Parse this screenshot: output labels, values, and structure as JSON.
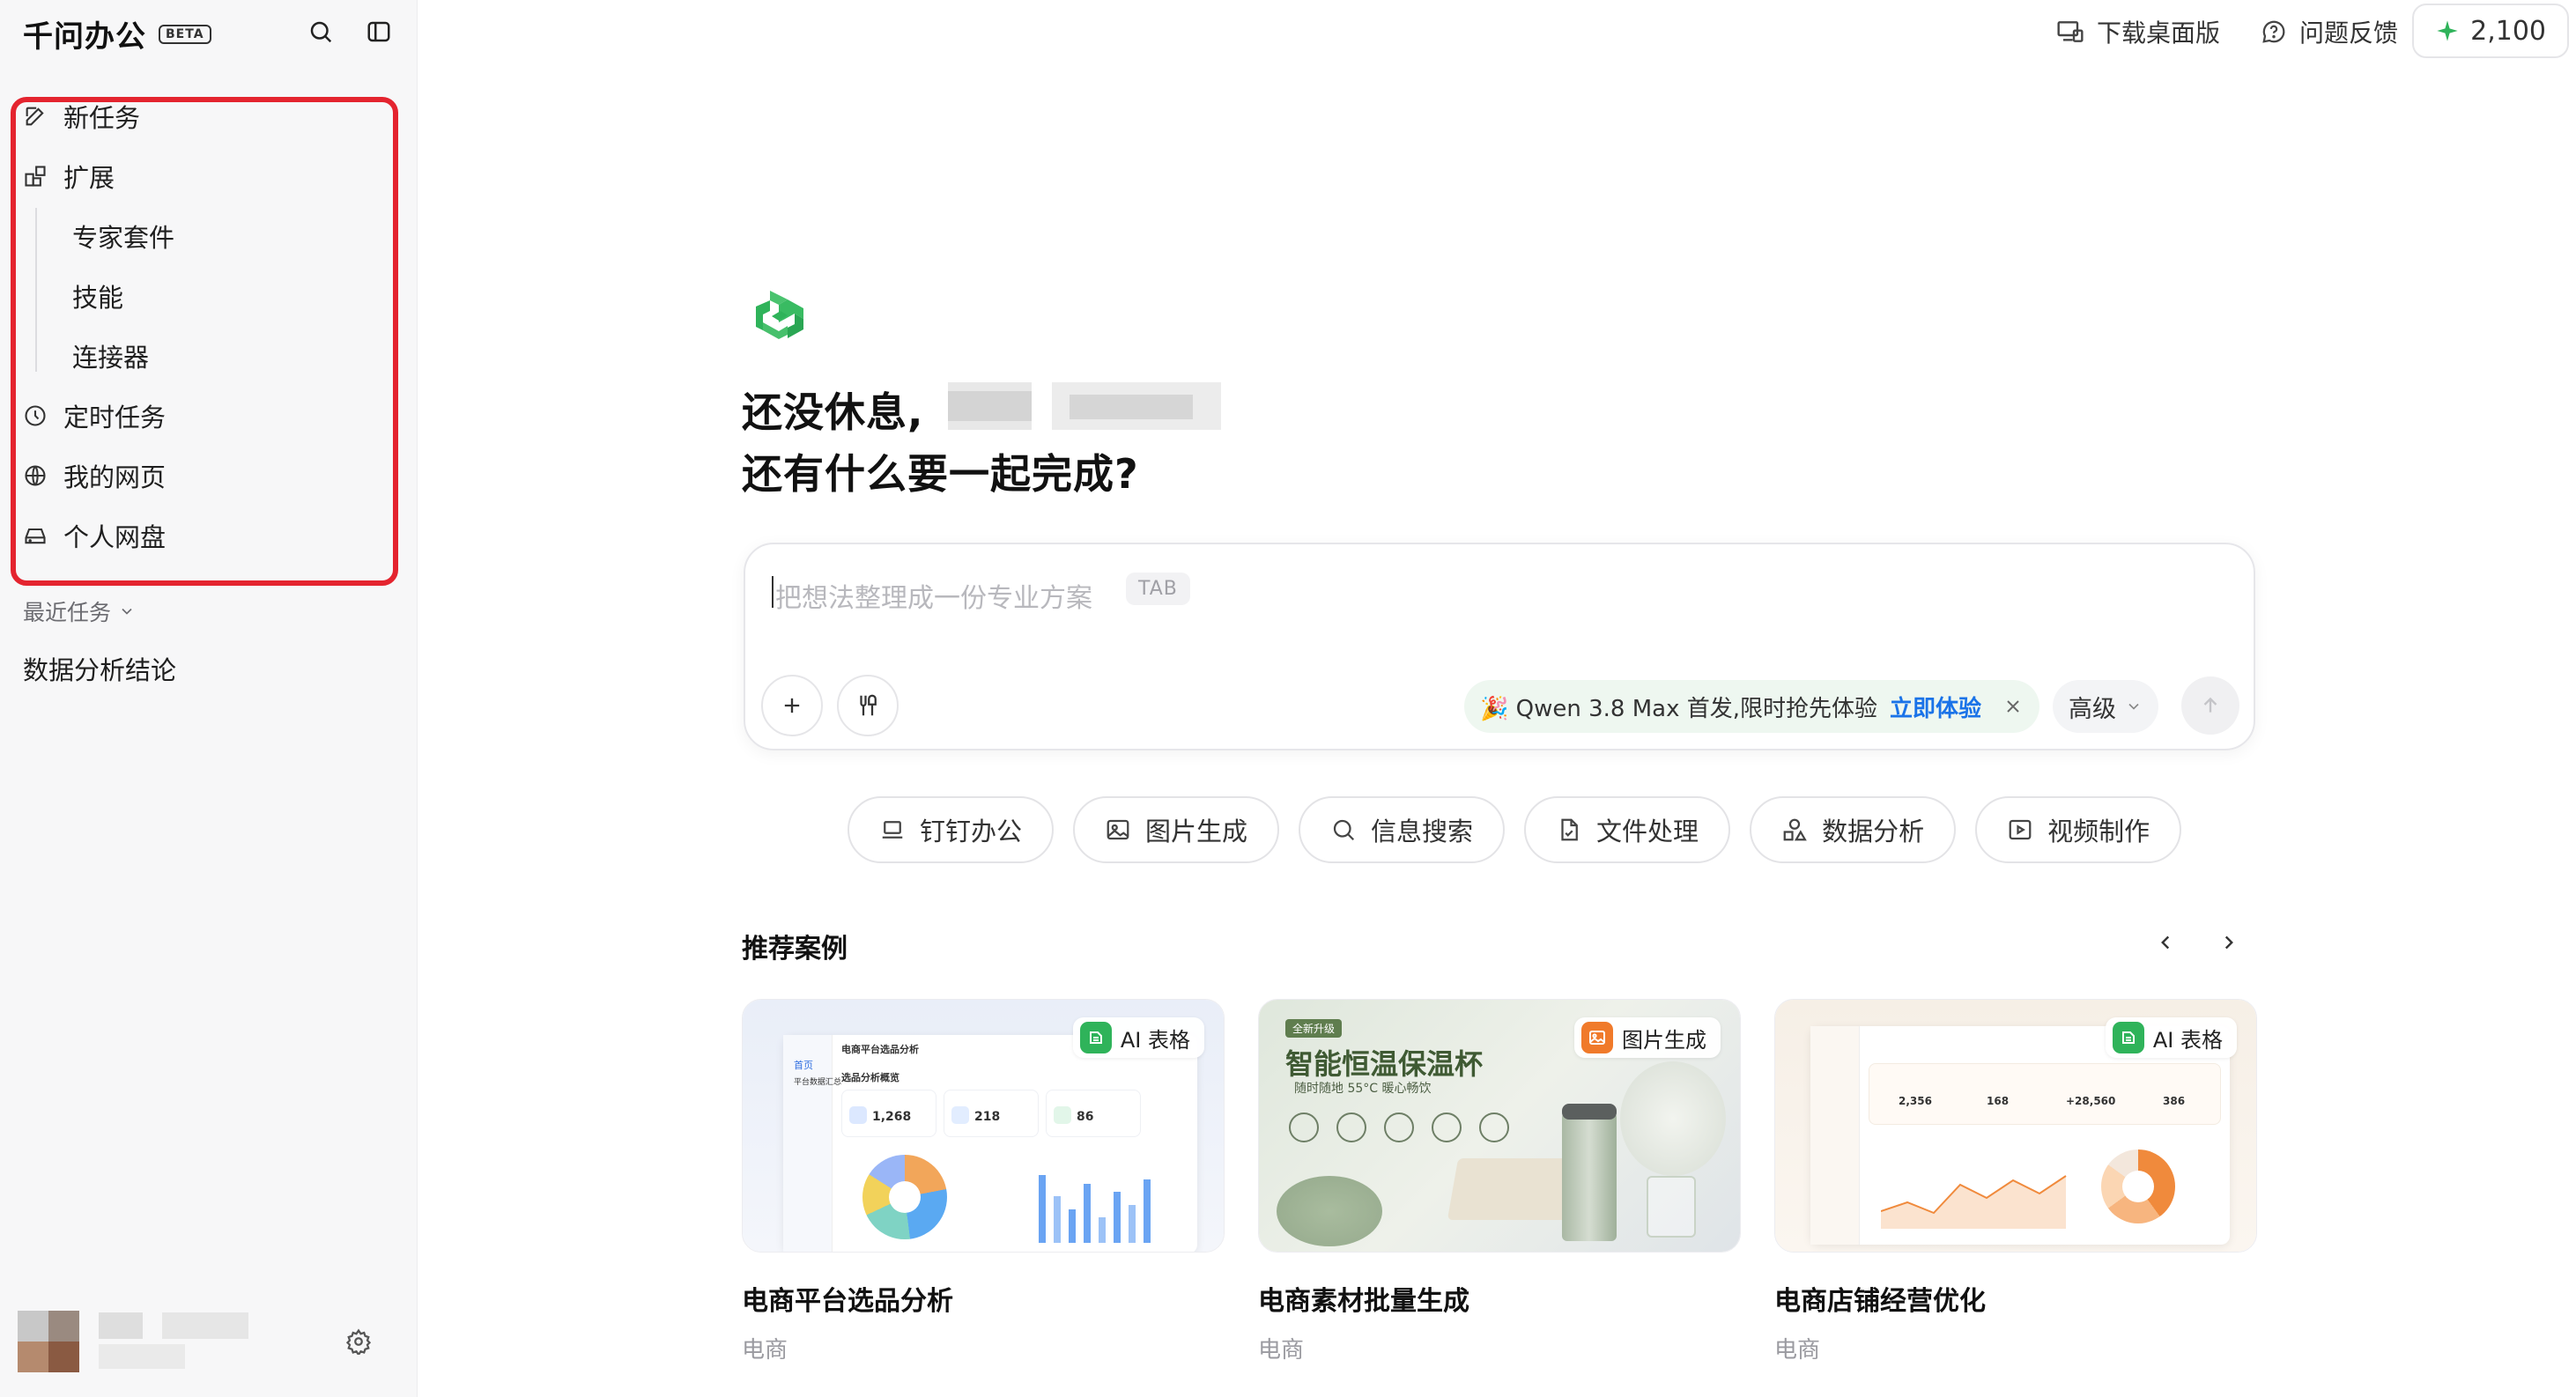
{
  "app": {
    "name": "千问办公",
    "beta": "BETA"
  },
  "sidebar": {
    "nav": [
      {
        "label": "新任务",
        "icon": "edit-icon"
      },
      {
        "label": "扩展",
        "icon": "extensions-icon"
      },
      {
        "label": "定时任务",
        "icon": "clock-icon"
      },
      {
        "label": "我的网页",
        "icon": "globe-icon"
      },
      {
        "label": "个人网盘",
        "icon": "drive-icon"
      }
    ],
    "extensions_sub": [
      "专家套件",
      "技能",
      "连接器"
    ],
    "recent_header": "最近任务",
    "recent_items": [
      "数据分析结论"
    ]
  },
  "topbar": {
    "download": "下载桌面版",
    "feedback": "问题反馈",
    "credits": "2,100"
  },
  "greeting": {
    "line1": "还没休息,",
    "line2": "还有什么要一起完成?"
  },
  "composer": {
    "placeholder": "把想法整理成一份专业方案",
    "tab_hint": "TAB",
    "promo_text": "🎉 Qwen 3.8 Max 首发,限时抢先体验",
    "promo_cta": "立即体验",
    "advanced": "高级"
  },
  "chips": [
    "钉钉办公",
    "图片生成",
    "信息搜索",
    "文件处理",
    "数据分析",
    "视频制作"
  ],
  "recommended": {
    "title": "推荐案例",
    "cards": [
      {
        "title": "电商平台选品分析",
        "tag": "电商",
        "badge": "AI 表格",
        "preview": {
          "header": "电商平台选品分析",
          "section": "选品分析概览",
          "kpis": [
            "1,268",
            "218",
            "86"
          ],
          "nav": [
            "首页",
            "平台数据汇总"
          ]
        }
      },
      {
        "title": "电商素材批量生成",
        "tag": "电商",
        "badge": "图片生成",
        "preview": {
          "ribbon": "全新升级",
          "headline": "智能恒温保温杯",
          "sub": "随时随地 55°C 暖心畅饮"
        }
      },
      {
        "title": "电商店铺经营优化",
        "tag": "电商",
        "badge": "AI 表格",
        "preview": {
          "kpis": [
            "2,356",
            "168",
            "+28,560",
            "386"
          ]
        }
      }
    ]
  },
  "colors": {
    "accent": "#1a73e8",
    "brand_green": "#2fb35a",
    "highlight_red": "#e4242f",
    "badge_orange": "#f07a2a"
  }
}
